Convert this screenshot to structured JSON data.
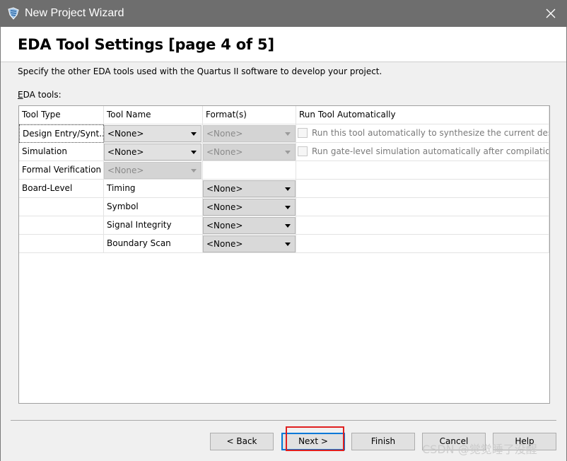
{
  "window": {
    "title": "New Project Wizard",
    "app_icon": "quartus-wizard-icon",
    "close_icon": "close-icon"
  },
  "header": {
    "title": "EDA Tool Settings [page 4 of 5]"
  },
  "description": "Specify the other EDA tools used with the Quartus II software to develop your project.",
  "eda_tools_label": {
    "prefix": "E",
    "rest": "DA tools:"
  },
  "table": {
    "columns": [
      "Tool Type",
      "Tool Name",
      "Format(s)",
      "Run Tool Automatically"
    ],
    "rows": [
      {
        "type": "Design Entry/Synt...",
        "tool": "<None>",
        "format": "<None>",
        "run": "Run this tool automatically to synthesize the current design"
      },
      {
        "type": "Simulation",
        "tool": "<None>",
        "format": "<None>",
        "run": "Run gate-level simulation automatically after compilation"
      },
      {
        "type": "Formal Verification",
        "tool": "<None>"
      },
      {
        "type": "Board-Level",
        "tool": "Timing",
        "format": "<None>"
      },
      {
        "type": "",
        "tool": "Symbol",
        "format": "<None>"
      },
      {
        "type": "",
        "tool": "Signal Integrity",
        "format": "<None>"
      },
      {
        "type": "",
        "tool": "Boundary Scan",
        "format": "<None>"
      }
    ]
  },
  "buttons": {
    "back": "< Back",
    "next": "Next >",
    "finish": "Finish",
    "cancel": "Cancel",
    "help": "Help"
  },
  "watermark": "CSDN @觉觉睡了没醒",
  "colors": {
    "titlebar": "#6e6e6e",
    "highlight": "#e02020",
    "default_button_border": "#0078d7"
  }
}
